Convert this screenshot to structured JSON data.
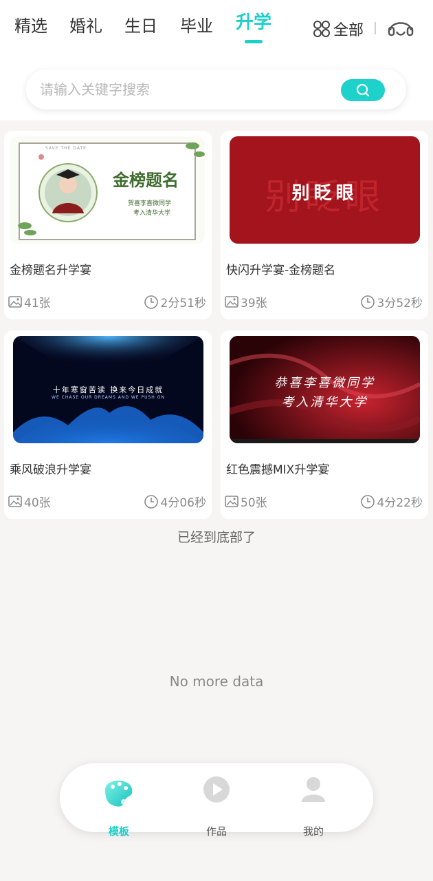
{
  "tabs": [
    {
      "label": "精选"
    },
    {
      "label": "婚礼"
    },
    {
      "label": "生日"
    },
    {
      "label": "毕业"
    },
    {
      "label": "升学"
    }
  ],
  "header": {
    "all_label": "全部"
  },
  "search": {
    "placeholder": "请输入关键字搜索"
  },
  "cards": [
    {
      "title": "金榜题名升学宴",
      "photos": "41张",
      "duration": "2分51秒",
      "thumb_text": "金榜题名",
      "thumb_sub1": "贺喜李喜微同学",
      "thumb_sub2": "考入清华大学",
      "thumb_banner": "SAVE THE DATE"
    },
    {
      "title": "快闪升学宴-金榜题名",
      "photos": "39张",
      "duration": "3分52秒",
      "thumb_text": "别眨眼"
    },
    {
      "title": "乘风破浪升学宴",
      "photos": "40张",
      "duration": "4分06秒",
      "thumb_text": "十年寒窗苦读  换来今日成就",
      "thumb_sub1": "WE CHASE OUR DREAMS AND WE PUSH ON"
    },
    {
      "title": "红色震撼MIX升学宴",
      "photos": "50张",
      "duration": "4分22秒",
      "thumb_text": "恭喜李喜微同学",
      "thumb_sub1": "考入清华大学"
    }
  ],
  "footer": {
    "end_text": "已经到底部了",
    "no_more": "No more data"
  },
  "nav": [
    {
      "label": "模板",
      "icon": "palette-icon"
    },
    {
      "label": "作品",
      "icon": "play-icon"
    },
    {
      "label": "我的",
      "icon": "user-icon"
    }
  ],
  "colors": {
    "accent": "#1ccfc9",
    "background": "#f6f5f3"
  }
}
